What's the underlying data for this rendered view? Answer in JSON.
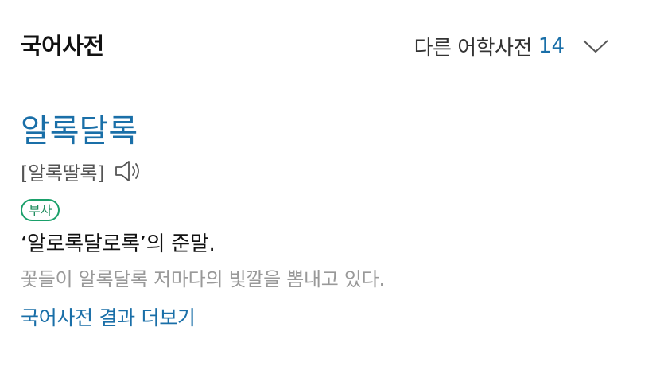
{
  "header": {
    "title": "국어사전",
    "other_dicts_label": "다른 어학사전",
    "other_dicts_count": "14",
    "chevron_icon": "chevron-down-icon"
  },
  "entry": {
    "headword": "알록달록",
    "pronunciation": "[알록딸록]",
    "speaker_icon": "speaker-icon",
    "part_of_speech": "부사",
    "definition": "‘알로록달로록’의 준말.",
    "example": "꽃들이 알록달록 저마다의 빛깔을 뽐내고 있다."
  },
  "footer": {
    "more_link": "국어사전 결과 더보기"
  },
  "colors": {
    "link_blue": "#1a6fa8",
    "badge_green": "#1aa06a",
    "example_gray": "#999999"
  }
}
